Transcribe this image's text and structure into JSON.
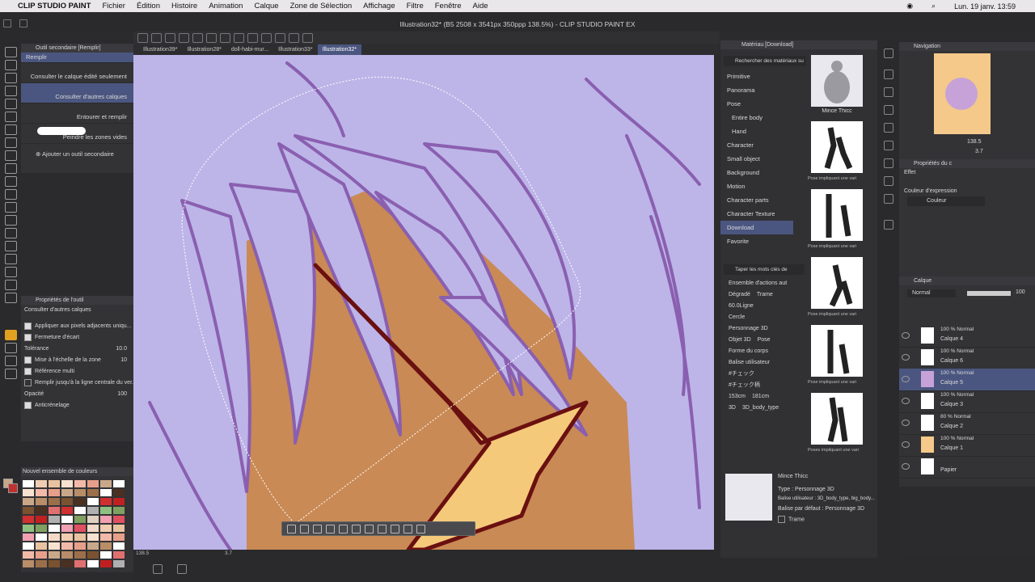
{
  "macmenu": {
    "app": "CLIP STUDIO PAINT",
    "items": [
      "Fichier",
      "Édition",
      "Histoire",
      "Animation",
      "Calque",
      "Zone de Sélection",
      "Affichage",
      "Filtre",
      "Fenêtre",
      "Aide"
    ],
    "clock": "Lun. 19 janv.  13:59"
  },
  "window": {
    "title": "Illustration32* (B5 2508 x 3541px 350ppp 138.5%) - CLIP STUDIO PAINT EX"
  },
  "doc_tabs": [
    "Illustration39*",
    "Illustration28*",
    "doll-habi-mur...",
    "Illustration33*",
    "Illustration32*"
  ],
  "subtool": {
    "title": "Outil secondaire [Remplir]",
    "group": "Remplir",
    "items": [
      "Consulter le calque édité seulement",
      "Consulter d'autres calques",
      "Entourer et remplir",
      "Peindre les zones vides"
    ],
    "add": "Ajouter un outil secondaire"
  },
  "toolprops": {
    "title": "Propriétés de l'outil",
    "subtitle": "Consulter d'autres calques",
    "rows": [
      {
        "label": "Appliquer aux pixels adjacents uniqu...",
        "value": ""
      },
      {
        "label": "Fermeture d'écart",
        "value": ""
      },
      {
        "label": "Tolérance",
        "value": "10.0"
      },
      {
        "label": "Mise à l'échelle de la zone",
        "value": "10"
      },
      {
        "label": "Référence multi",
        "value": ""
      },
      {
        "label": "Remplir jusqu'à la ligne centrale du ver...",
        "value": ""
      },
      {
        "label": "Opacité",
        "value": "100"
      },
      {
        "label": "Anticrénelage",
        "value": ""
      }
    ]
  },
  "palette": {
    "title": "Nouvel ensemble de couleurs"
  },
  "material": {
    "title": "Matériau [Download]",
    "search": "Rechercher des matériaux su",
    "tree": [
      "Primitive",
      "Panorama",
      "Pose",
      "Entire body",
      "Hand",
      "Character",
      "Small object",
      "Background",
      "Motion",
      "Character parts",
      "Character Texture",
      "Download",
      "Favorite"
    ],
    "tag_search": "Taper les mots clés de",
    "tags": [
      "Ensemble d'actions aut",
      "Dégradé",
      "Trame",
      "60.0Ligne",
      "Cercle",
      "Personnage 3D",
      "Objet 3D",
      "Pose",
      "Forme du corps",
      "Balise utilisateur",
      "#チェック",
      "#チェック柄",
      "153cm",
      "181cm",
      "3D",
      "3D_body_type"
    ],
    "thumbs": [
      "Mince Thicc",
      "Pose impliquant une vari",
      "Pose impliquant une vari",
      "Pose impliquant une vari",
      "Pose impliquant une vari",
      "Poses impliquant une vari"
    ],
    "detail": {
      "name": "Mince Thicc",
      "type": "Type : Personnage 3D",
      "usertag": "Balise utilisateur : 3D_body_type, big_body...",
      "default": "Balise par défaut : Personnage 3D",
      "trame": "Trame"
    }
  },
  "navigation": {
    "title": "Navigation",
    "zoom": "138.5",
    "angle": "3.7"
  },
  "layerprops": {
    "title": "Propriétés du c",
    "effect": "Effet",
    "expression": "Couleur d'expression",
    "color": "Couleur"
  },
  "layers": {
    "title": "Calque",
    "blend": "Normal",
    "opacity": "100",
    "items": [
      {
        "mode": "100 % Normal",
        "name": "Calque 4"
      },
      {
        "mode": "100 % Normal",
        "name": "Calque 6"
      },
      {
        "mode": "100 % Normal",
        "name": "Calque 5"
      },
      {
        "mode": "100 % Normal",
        "name": "Calque 3"
      },
      {
        "mode": "80 % Normal",
        "name": "Calque 2"
      },
      {
        "mode": "100 % Normal",
        "name": "Calque 1"
      },
      {
        "mode": "",
        "name": "Papier"
      }
    ]
  },
  "status": {
    "zoom": "138.5",
    "angle": "3.7"
  },
  "colors": {
    "accent": "#4b5680",
    "canvas_bg": "#bdb5e8",
    "hair": "#8a5fb0",
    "skin": "#c98a55",
    "beak": "#f5c97a",
    "outline": "#6a1010"
  }
}
